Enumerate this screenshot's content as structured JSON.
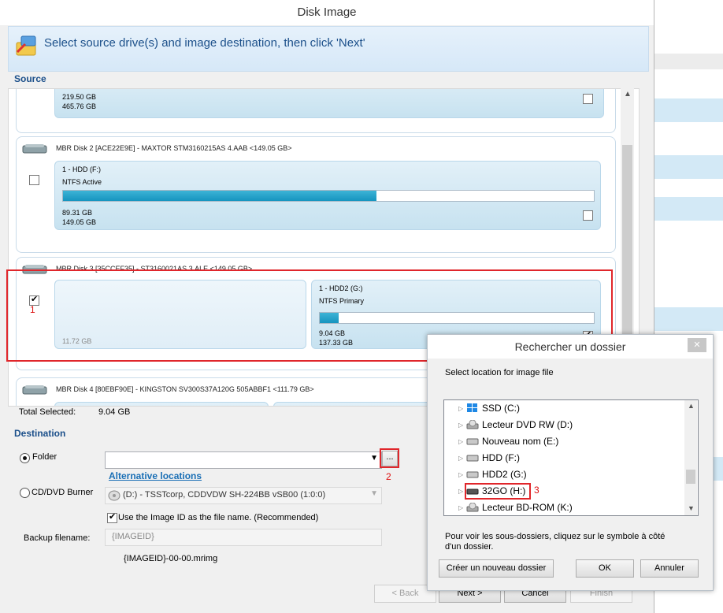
{
  "window": {
    "title": "Disk Image"
  },
  "header": {
    "text": "Select source drive(s) and image destination, then click 'Next'"
  },
  "source": {
    "label": "Source",
    "disk1": {
      "size1": "219.50 GB",
      "size2": "465.76 GB"
    },
    "disk2": {
      "title": "MBR Disk 2 [ACE22E9E] - MAXTOR STM3160215AS 4.AAB  <149.05 GB>",
      "partition": {
        "name": "1 - HDD (F:)",
        "type": "NTFS Active",
        "fill": 0.59,
        "size1": "89.31 GB",
        "size2": "149.05 GB"
      }
    },
    "disk3": {
      "title": "MBR Disk 3 [35CCEF35] - ST3160021AS 3.ALE  <149.05 GB>",
      "unallocated_size": "11.72 GB",
      "partition": {
        "name": "1 - HDD2 (G:)",
        "type": "NTFS Primary",
        "fill": 0.07,
        "size1": "9.04 GB",
        "size2": "137.33 GB"
      }
    },
    "disk4": {
      "title": "MBR Disk 4 [80EBF90E] - KINGSTON SV300S37A120G 505ABBF1  <111.79 GB>"
    },
    "total_label": "Total Selected:",
    "total_value": "9.04 GB"
  },
  "destination": {
    "label": "Destination",
    "folder_label": "Folder",
    "browse_label": "...",
    "alt_locations": "Alternative locations",
    "cd_label": "CD/DVD Burner",
    "cd_value": "(D:) - TSSTcorp, CDDVDW SH-224BB  vSB00 (1:0:0)",
    "use_id_label": "Use the Image ID as the file name.  (Recommended)",
    "backup_label": "Backup filename:",
    "backup_value": "{IMAGEID}",
    "filename_preview": "{IMAGEID}-00-00.mrimg"
  },
  "annotations": {
    "one": "1",
    "two": "2",
    "three": "3"
  },
  "nav": {
    "back": "< Back",
    "next": "Next >",
    "cancel": "Cancel",
    "finish": "Finish"
  },
  "dialog": {
    "title": "Rechercher un dossier",
    "close": "✕",
    "instruction": "Select location for image file",
    "items": [
      "SSD (C:)",
      "Lecteur DVD RW (D:)",
      "Nouveau nom (E:)",
      "HDD (F:)",
      "HDD2 (G:)",
      "32GO (H:)",
      "Lecteur BD-ROM (K:)"
    ],
    "help": "Pour voir les sous-dossiers, cliquez sur le symbole à côté d'un dossier.",
    "new_folder": "Créer un nouveau dossier",
    "ok": "OK",
    "cancel": "Annuler"
  },
  "colors": {
    "accent": "#1b4f8a",
    "bar": "#1594bf",
    "highlight": "#e0262b"
  }
}
